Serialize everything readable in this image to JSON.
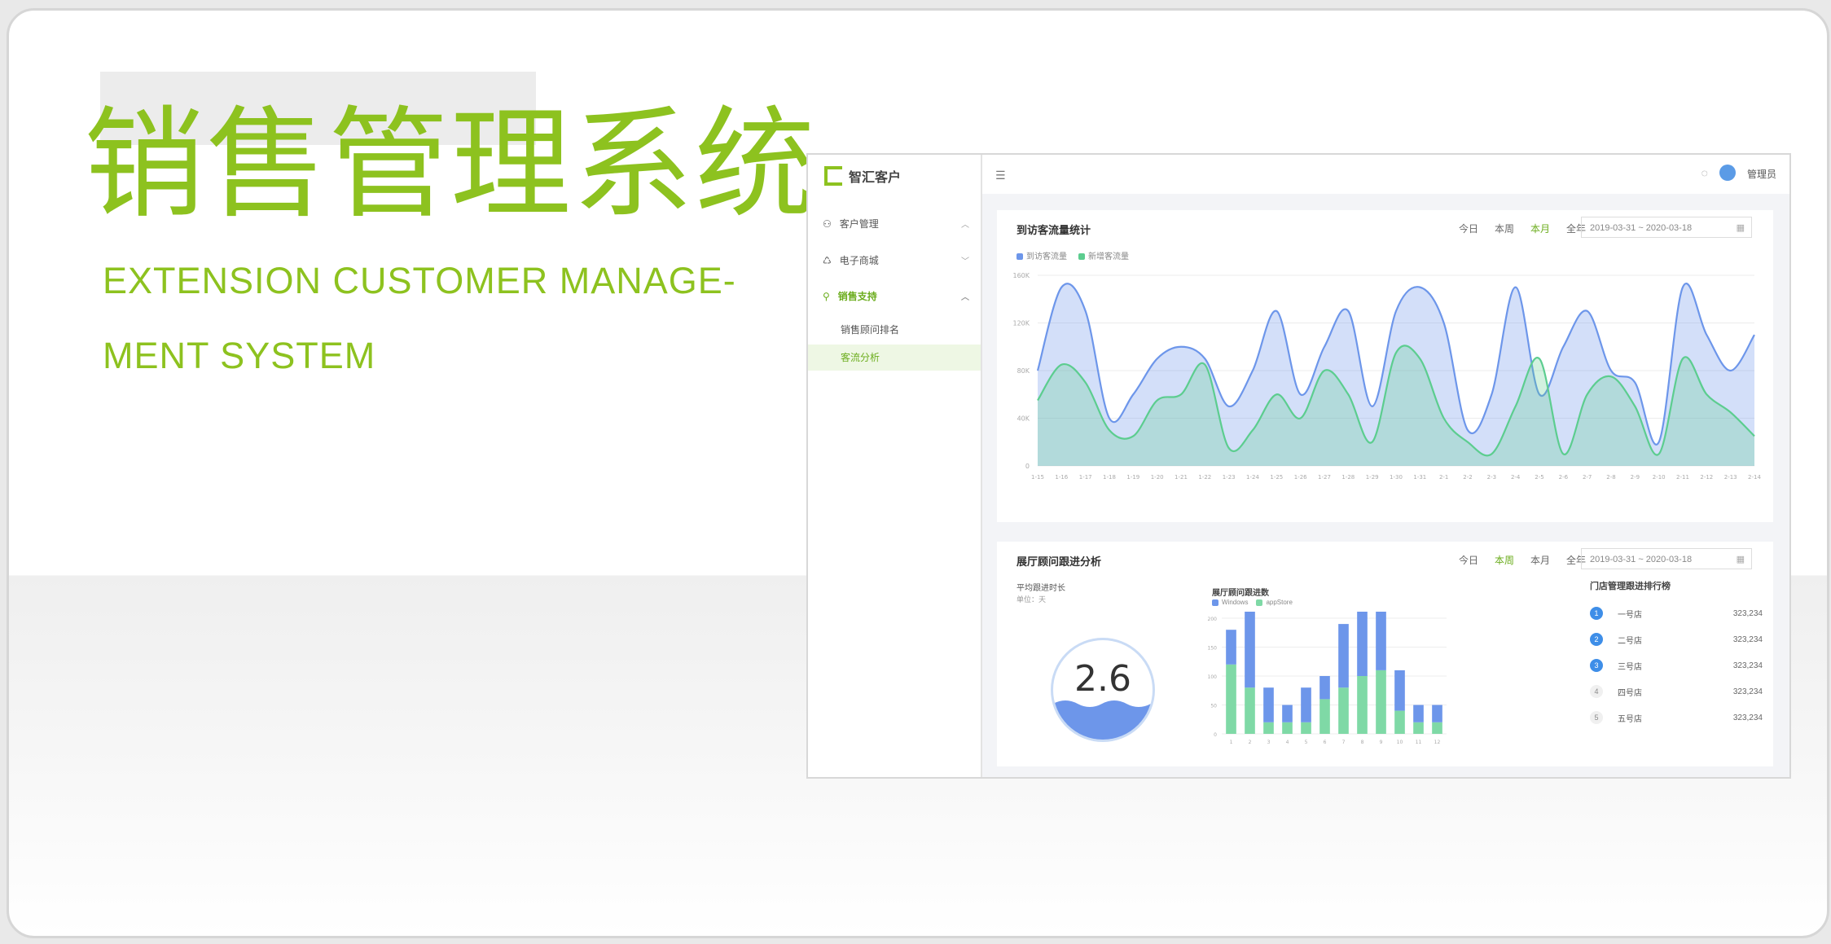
{
  "hero": {
    "title": "销售管理系统",
    "subtitle_line1": "EXTENSION CUSTOMER MANAGE-",
    "subtitle_line2": "MENT SYSTEM",
    "accent_color": "#8dc21f"
  },
  "app": {
    "logo_text": "智汇客户",
    "sidebar": {
      "items": [
        {
          "label": "客户管理",
          "icon": "users-icon",
          "active": false
        },
        {
          "label": "电子商城",
          "icon": "cart-icon",
          "active": false
        },
        {
          "label": "销售支持",
          "icon": "location-icon",
          "active": true
        }
      ],
      "sub_items": [
        {
          "label": "销售顾问排名",
          "active": false
        },
        {
          "label": "客流分析",
          "active": true
        }
      ]
    },
    "topbar": {
      "user_name": "管理员"
    }
  },
  "panel1": {
    "title": "到访客流量统计",
    "tabs": [
      "今日",
      "本周",
      "本月",
      "全年"
    ],
    "active_tab": "本月",
    "date_range": "2019-03-31 ~ 2020-03-18",
    "legend": [
      "到访客流量",
      "新增客流量"
    ]
  },
  "panel2": {
    "title": "展厅顾问跟进分析",
    "tabs": [
      "今日",
      "本周",
      "本月",
      "全年"
    ],
    "active_tab": "本周",
    "date_range": "2019-03-31 ~ 2020-03-18",
    "kpi_title": "平均跟进时长",
    "kpi_sub": "单位：天",
    "kpi_value": "2.6",
    "bar_title": "展厅顾问跟进数",
    "bar_legend": [
      "Windows",
      "appStore"
    ],
    "rank_title": "门店管理跟进排行榜",
    "ranking": [
      {
        "rank": "1",
        "name": "一号店",
        "value": "323,234"
      },
      {
        "rank": "2",
        "name": "二号店",
        "value": "323,234"
      },
      {
        "rank": "3",
        "name": "三号店",
        "value": "323,234"
      },
      {
        "rank": "4",
        "name": "四号店",
        "value": "323,234"
      },
      {
        "rank": "5",
        "name": "五号店",
        "value": "323,234"
      }
    ]
  },
  "chart_data": [
    {
      "type": "area",
      "title": "到访客流量统计",
      "x": [
        "1-15",
        "1-16",
        "1-17",
        "1-18",
        "1-19",
        "1-20",
        "1-21",
        "1-22",
        "1-23",
        "1-24",
        "1-25",
        "1-26",
        "1-27",
        "1-28",
        "1-29",
        "1-30",
        "1-31",
        "2-1",
        "2-2",
        "2-3",
        "2-4",
        "2-5",
        "2-6",
        "2-7",
        "2-8",
        "2-9",
        "2-10",
        "2-11",
        "2-12",
        "2-13",
        "2-14"
      ],
      "y_ticks": [
        "0",
        "40K",
        "80K",
        "120K",
        "160K"
      ],
      "ylim": [
        0,
        160
      ],
      "series": [
        {
          "name": "到访客流量",
          "color": "#6d96ea",
          "values": [
            80,
            150,
            130,
            40,
            60,
            90,
            100,
            90,
            50,
            80,
            130,
            60,
            100,
            130,
            50,
            130,
            150,
            120,
            30,
            60,
            150,
            60,
            100,
            130,
            80,
            70,
            20,
            150,
            110,
            80,
            110
          ]
        },
        {
          "name": "新增客流量",
          "color": "#5ccd8f",
          "values": [
            55,
            85,
            70,
            30,
            25,
            55,
            60,
            85,
            15,
            30,
            60,
            40,
            80,
            60,
            20,
            95,
            90,
            40,
            20,
            10,
            50,
            90,
            10,
            60,
            75,
            50,
            10,
            90,
            60,
            45,
            25
          ]
        }
      ]
    },
    {
      "type": "bar",
      "title": "展厅顾问跟进数",
      "categories": [
        "1",
        "2",
        "3",
        "4",
        "5",
        "6",
        "7",
        "8",
        "9",
        "10",
        "11",
        "12"
      ],
      "y_ticks": [
        "0",
        "50",
        "100",
        "150",
        "200"
      ],
      "ylim": [
        0,
        200
      ],
      "series": [
        {
          "name": "Windows",
          "color": "#6d96ea",
          "values": [
            60,
            140,
            60,
            30,
            60,
            40,
            110,
            120,
            140,
            70,
            30,
            30
          ]
        },
        {
          "name": "appStore",
          "color": "#7fd9a6",
          "values": [
            120,
            80,
            20,
            20,
            20,
            60,
            80,
            100,
            110,
            40,
            20,
            20
          ]
        }
      ]
    }
  ]
}
